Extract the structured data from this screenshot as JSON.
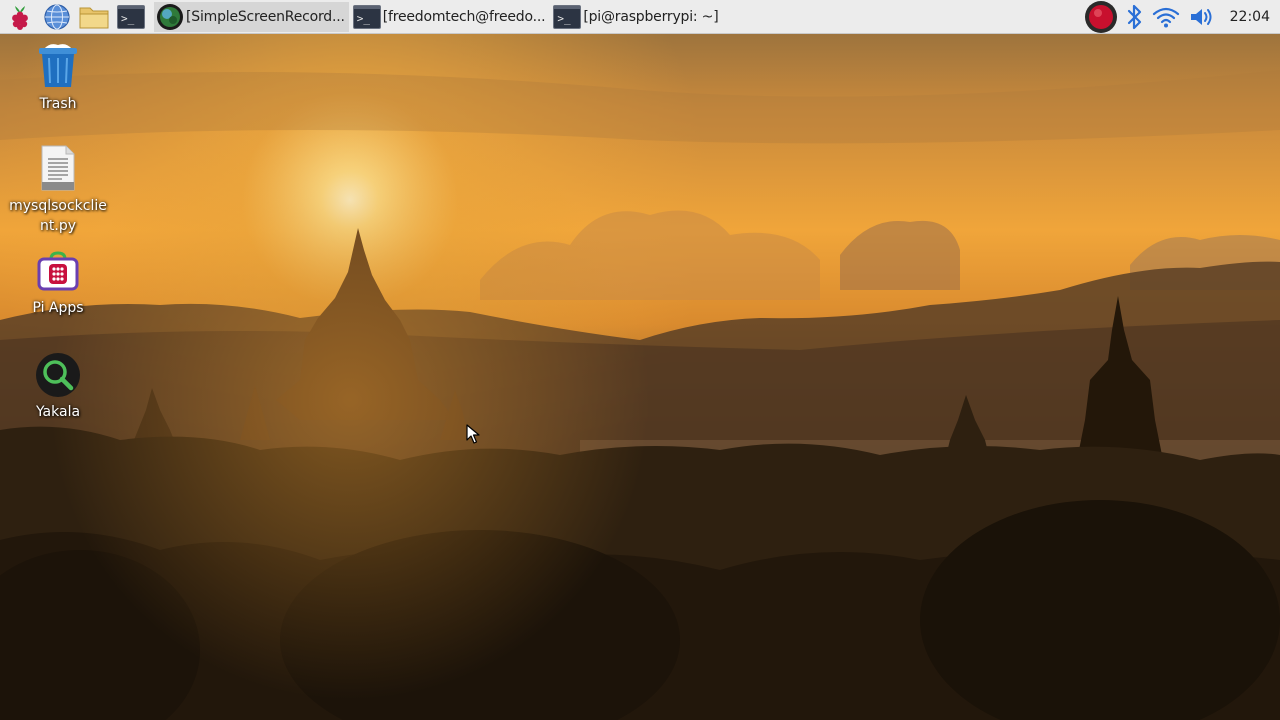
{
  "taskbar": {
    "launchers": [
      {
        "name": "raspberry-menu",
        "icon": "raspberry-icon"
      },
      {
        "name": "web-browser",
        "icon": "globe-icon"
      },
      {
        "name": "file-manager",
        "icon": "folder-icon"
      },
      {
        "name": "terminal",
        "icon": "terminal-icon"
      }
    ],
    "tasks": [
      {
        "label": "[SimpleScreenRecord...",
        "icon": "screen-recorder-icon"
      },
      {
        "label": "[freedomtech@freedo...",
        "icon": "terminal-icon"
      },
      {
        "label": "[pi@raspberrypi: ~]",
        "icon": "terminal-icon"
      }
    ],
    "tray": {
      "recorder": "record-icon",
      "bluetooth": "bluetooth-icon",
      "wifi": "wifi-icon",
      "volume": "volume-icon",
      "clock": "22:04"
    }
  },
  "desktop": {
    "icons": [
      {
        "label": "Trash",
        "icon": "trash-icon"
      },
      {
        "label": "mysqlsockclient.py",
        "icon": "text-file-icon"
      },
      {
        "label": "Pi Apps",
        "icon": "pi-apps-icon"
      },
      {
        "label": "Yakala",
        "icon": "magnifier-icon"
      }
    ]
  },
  "colors": {
    "taskbar_bg": "#ececec",
    "sky_gold": "#f0a53a",
    "sun": "#fff3c4"
  }
}
